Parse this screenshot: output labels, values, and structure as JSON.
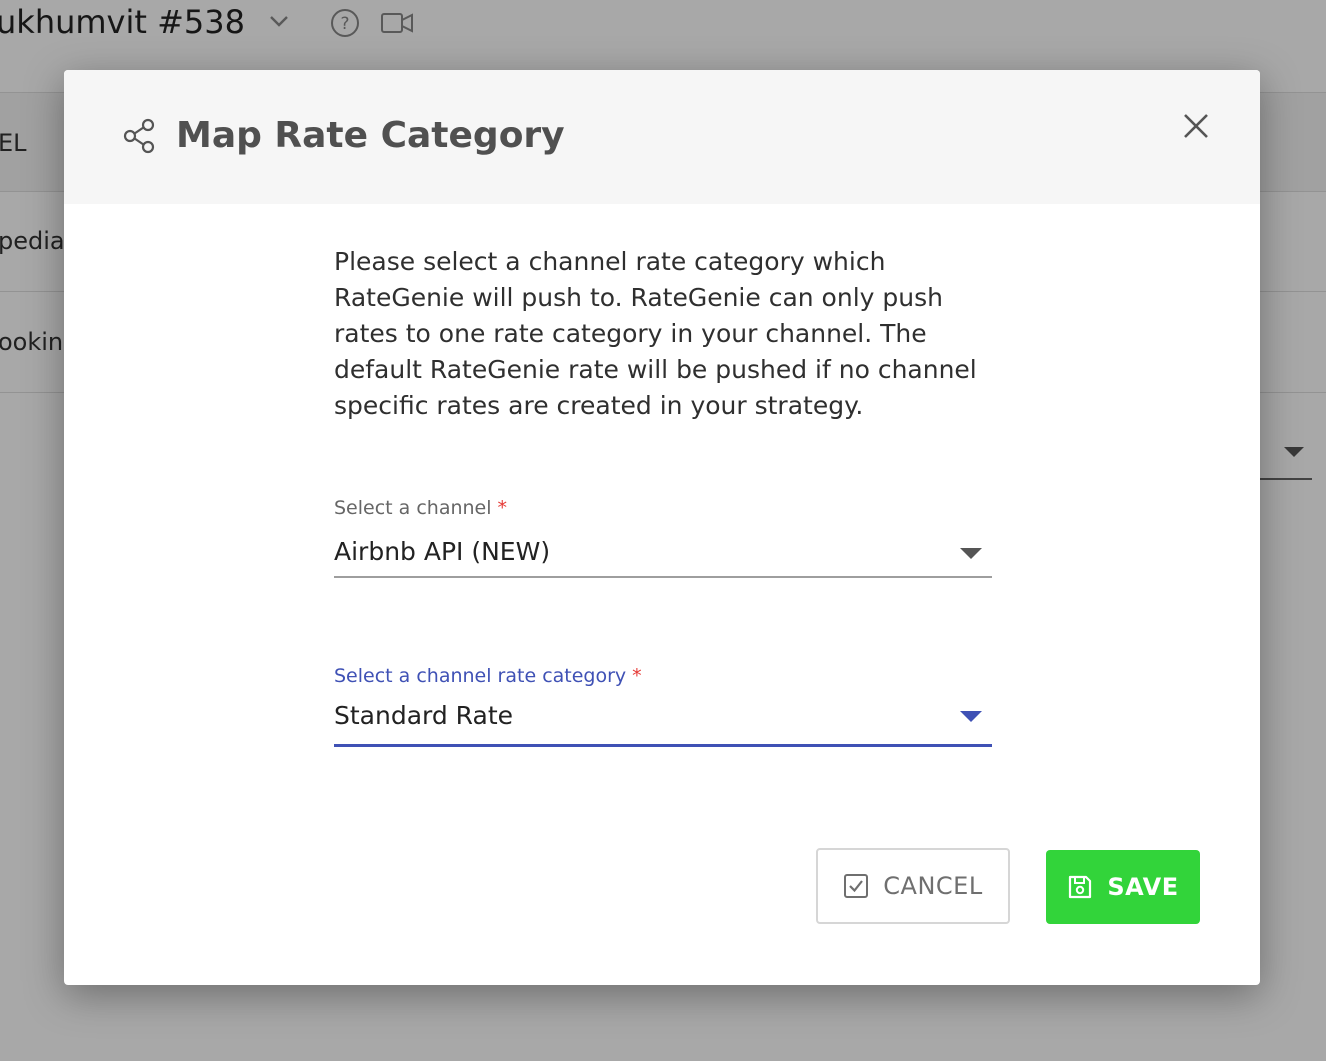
{
  "background": {
    "page_title": "ukhumvit #538",
    "header_cell": "EL",
    "rows": [
      "pedia",
      "ooking"
    ]
  },
  "modal": {
    "title": "Map Rate Category",
    "description": "Please select a channel rate category which RateGenie will push to. RateGenie can only push rates to one rate category in your channel. The default RateGenie rate will be pushed if no channel specific rates are created in your strategy.",
    "channel_field": {
      "label": "Select a channel",
      "required_mark": "*",
      "value": "Airbnb API (NEW)"
    },
    "rate_category_field": {
      "label": "Select a channel rate category",
      "required_mark": "*",
      "value": "Standard Rate"
    },
    "cancel_label": "CANCEL",
    "save_label": "SAVE"
  },
  "colors": {
    "accent": "#3f51b5",
    "save": "#32d43a",
    "required": "#e53935"
  },
  "icons": [
    "chevron-down-icon",
    "help-icon",
    "video-icon",
    "share-icon",
    "close-icon",
    "checkbox-icon",
    "save-icon"
  ]
}
